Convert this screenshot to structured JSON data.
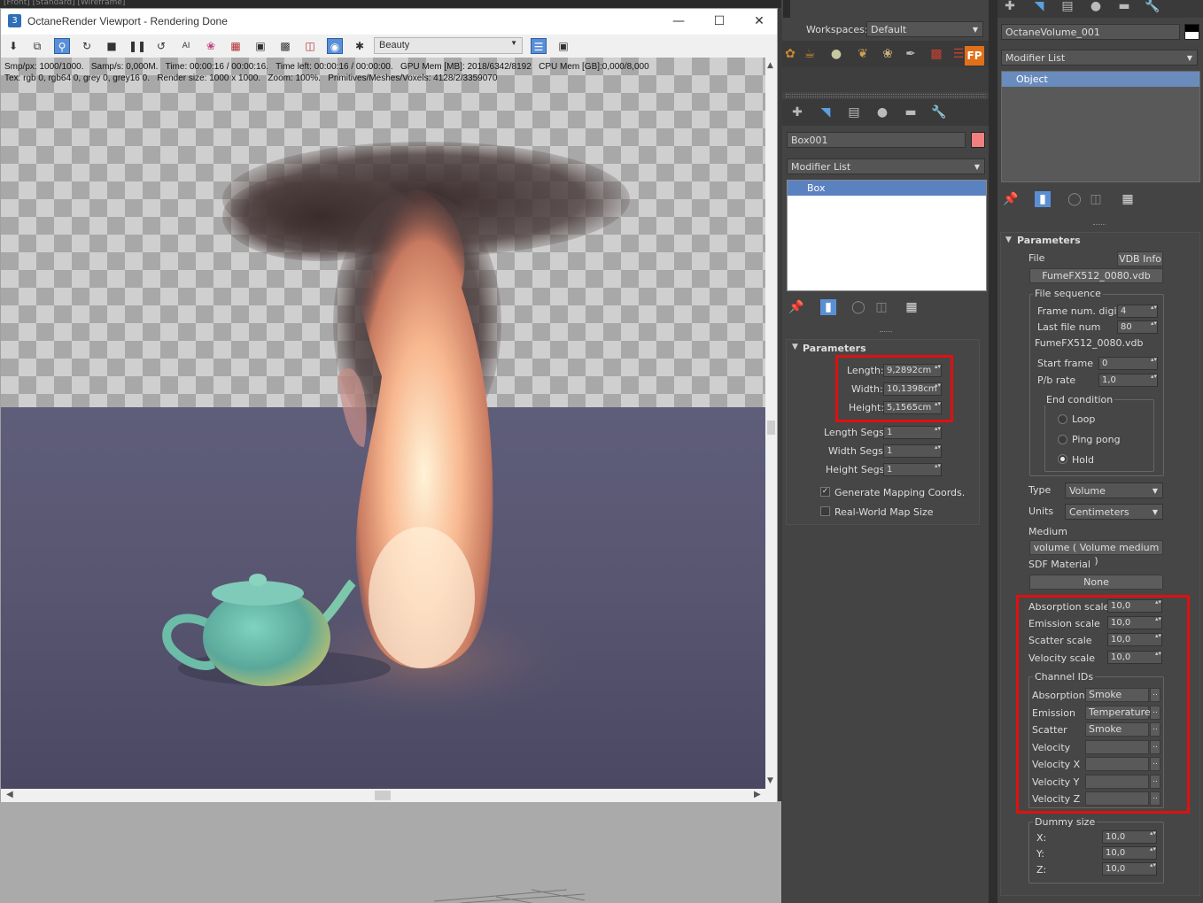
{
  "viewport": {
    "top_strip": "[Front] [Standard] [Wireframe]",
    "title": "OctaneRender Viewport - Rendering Done",
    "render_pass": "Beauty",
    "stats_line1": "Smp/px: 1000/1000.   Samp/s: 0,000M.   Time: 00:00:16 / 00:00:16.   Time left: 00:00:16 / 00:00:00.   GPU Mem [MB]: 2018/6342/8192   CPU Mem [GB]:0,000/8,000",
    "stats_line2": "Tex: rgb 0, rgb64 0, grey 0, grey16 0.   Render size: 1000 x 1000.   Zoom: 100%.   Primitives/Meshes/Voxels: 4128/2/3359070",
    "toolbar_icons": [
      "save-icon",
      "copy-icon",
      "zoom-icon",
      "refresh-icon",
      "lock-icon",
      "pause-icon",
      "restart-icon",
      "ai-light-icon",
      "color-wheel-icon",
      "grid-icon",
      "monitor-icon",
      "film-icon",
      "camera-region-icon",
      "camera-icon",
      "settings-icon"
    ]
  },
  "command_panel": {
    "workspace_label": "Workspaces:",
    "workspace_value": "Default",
    "fp_label": "FP",
    "object_name": "Box001",
    "object_color": "#f08080",
    "modifier_list": "Modifier List",
    "stack_item": "Box",
    "rollout_title": "Parameters",
    "length_label": "Length:",
    "length_value": "9,2892cm",
    "width_label": "Width:",
    "width_value": "10,1398cm",
    "height_label": "Height:",
    "height_value": "5,1565cm",
    "length_segs_label": "Length Segs:",
    "length_segs_value": "1",
    "width_segs_label": "Width Segs:",
    "width_segs_value": "1",
    "height_segs_label": "Height Segs:",
    "height_segs_value": "1",
    "gen_mapping_label": "Generate Mapping Coords.",
    "real_world_label": "Real-World Map Size"
  },
  "right_panel": {
    "object_name": "OctaneVolume_001",
    "modifier_list": "Modifier List",
    "stack_item": "Object",
    "rollout_title": "Parameters",
    "file_label": "File",
    "vdb_info": "VDB Info",
    "file_button": "FumeFX512_0080.vdb",
    "file_sequence": "File sequence",
    "frame_digits_label": "Frame num. digits",
    "frame_digits_value": "4",
    "last_file_label": "Last file num",
    "last_file_value": "80",
    "seq_file_name": "FumeFX512_0080.vdb",
    "start_frame_label": "Start frame",
    "start_frame_value": "0",
    "pb_rate_label": "P/b rate",
    "pb_rate_value": "1,0",
    "end_condition": "End condition",
    "loop_label": "Loop",
    "ping_pong_label": "Ping pong",
    "hold_label": "Hold",
    "type_label": "Type",
    "type_value": "Volume",
    "units_label": "Units",
    "units_value": "Centimeters",
    "medium_label": "Medium",
    "medium_value": "volume  ( Volume medium )",
    "sdf_label": "SDF Material",
    "sdf_value": "None",
    "absorption_scale_label": "Absorption scale",
    "absorption_scale_value": "10,0",
    "emission_scale_label": "Emission scale",
    "emission_scale_value": "10,0",
    "scatter_scale_label": "Scatter scale",
    "scatter_scale_value": "10,0",
    "velocity_scale_label": "Velocity scale",
    "velocity_scale_value": "10,0",
    "channel_ids": "Channel IDs",
    "channels": [
      {
        "label": "Absorption",
        "value": "Smoke"
      },
      {
        "label": "Emission",
        "value": "Temperature"
      },
      {
        "label": "Scatter",
        "value": "Smoke"
      },
      {
        "label": "Velocity",
        "value": ""
      },
      {
        "label": "Velocity X",
        "value": ""
      },
      {
        "label": "Velocity Y",
        "value": ""
      },
      {
        "label": "Velocity Z",
        "value": ""
      }
    ],
    "dummy_size": "Dummy size",
    "dummy_x_label": "X:",
    "dummy_x_value": "10,0",
    "dummy_y_label": "Y:",
    "dummy_y_value": "10,0",
    "dummy_z_label": "Z:",
    "dummy_z_value": "10,0"
  }
}
